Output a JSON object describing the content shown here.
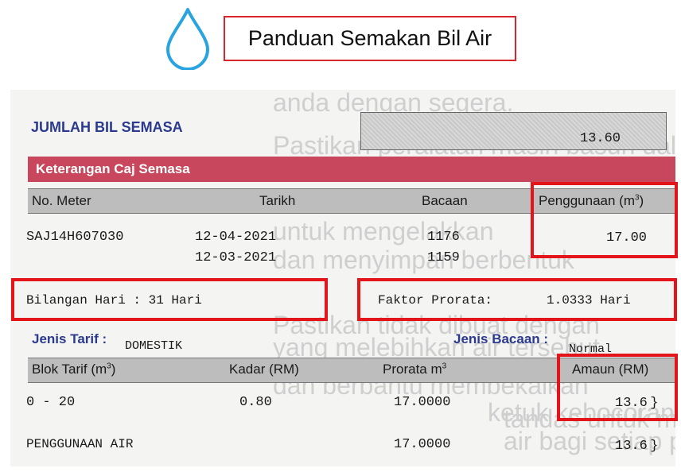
{
  "header": {
    "title": "Panduan Semakan Bil Air",
    "icon": "water-drop-icon",
    "accent": "#d9262c",
    "drop_color": "#29a4e0"
  },
  "bill": {
    "total_label": "JUMLAH BIL SEMASA",
    "total_value": "13.60",
    "section_title": "Keterangan Caj Semasa",
    "meter_headers": {
      "meter_no": "No. Meter",
      "date": "Tarikh",
      "reading": "Bacaan",
      "usage": "Penggunaan (m",
      "usage_sup": "3",
      "usage_close": ")"
    },
    "meter_no": "SAJ14H607030",
    "dates": [
      "12-04-2021",
      "12-03-2021"
    ],
    "readings": [
      "1176",
      "1159"
    ],
    "usage_value": "17.00",
    "days": "Bilangan Hari : 31 Hari",
    "prorata": "Faktor Prorata:",
    "prorata_value": "1.0333 Hari",
    "tariff_label": "Jenis Tarif :",
    "tariff_value": "DOMESTIK",
    "reading_type_label": "Jenis Bacaan :",
    "reading_type_value": "Normal",
    "tariff_headers": {
      "block": "Blok Tarif (m",
      "block_sup": "3",
      "block_close": ")",
      "rate": "Kadar (RM)",
      "prorata": "Prorata m",
      "prorata_sup": "3",
      "amount": "Amaun (RM)"
    },
    "rows": [
      {
        "block": "0 - 20",
        "rate": "0.80",
        "prorata": "17.0000",
        "amount": "13.6 }"
      },
      {
        "block": "PENGGUNAAN AIR",
        "rate": "",
        "prorata": "17.0000",
        "amount": "13.6 }"
      }
    ]
  }
}
